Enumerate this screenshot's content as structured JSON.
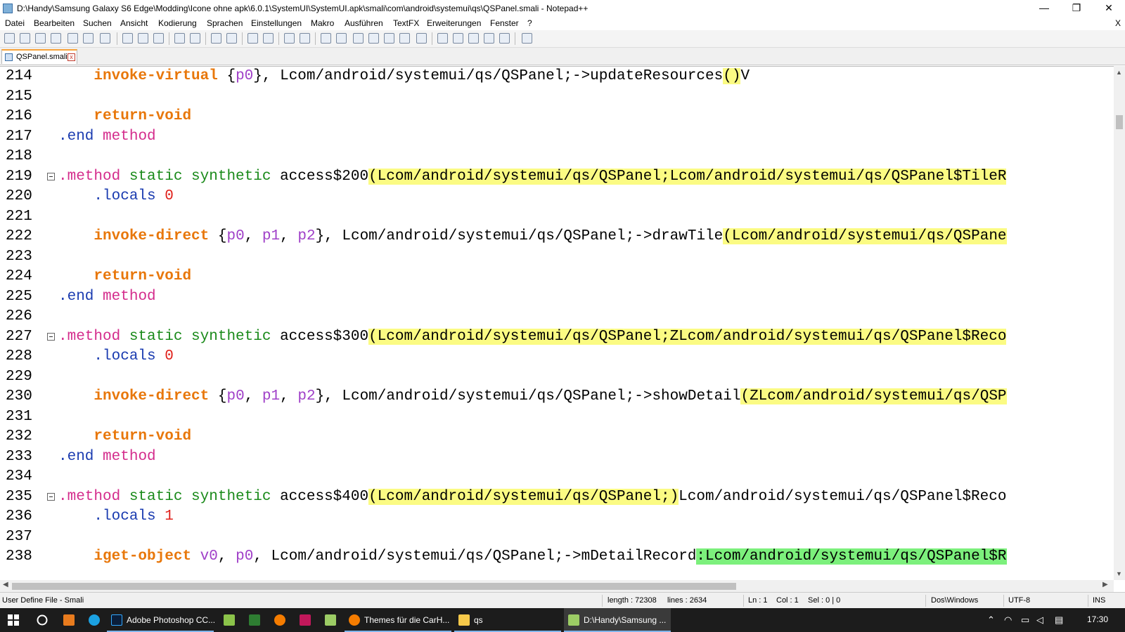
{
  "window": {
    "title": "D:\\Handy\\Samsung Galaxy S6 Edge\\Modding\\Icone ohne apk\\6.0.1\\SystemUI\\SystemUI.apk\\smali\\com\\android\\systemui\\qs\\QSPanel.smali - Notepad++",
    "minimize": "—",
    "restore": "❐",
    "close": "✕"
  },
  "menu": {
    "items": [
      "Datei",
      "Bearbeiten",
      "Suchen",
      "Ansicht",
      "Kodierung",
      "Sprachen",
      "Einstellungen",
      "Makro",
      "Ausführen",
      "TextFX",
      "Erweiterungen",
      "Fenster",
      "?"
    ],
    "doc_close": "X"
  },
  "tab": {
    "label": "QSPanel.smali",
    "close": "x"
  },
  "editor": {
    "lines": [
      {
        "n": "214",
        "tokens": [
          {
            "t": "    "
          },
          {
            "t": "invoke-virtual",
            "c": "kw-orange"
          },
          {
            "t": " {"
          },
          {
            "t": "p0",
            "c": "reg"
          },
          {
            "t": "}, Lcom/android/systemui/qs/QSPanel;->updateResources"
          },
          {
            "t": "()",
            "c": "hl-y"
          },
          {
            "t": "V"
          }
        ]
      },
      {
        "n": "215",
        "tokens": []
      },
      {
        "n": "216",
        "tokens": [
          {
            "t": "    "
          },
          {
            "t": "return-void",
            "c": "kw-orange"
          }
        ]
      },
      {
        "n": "217",
        "tokens": [
          {
            "t": ".end",
            "c": "kw-blue"
          },
          {
            "t": " "
          },
          {
            "t": "method",
            "c": "kw-pink"
          }
        ]
      },
      {
        "n": "218",
        "tokens": []
      },
      {
        "n": "219",
        "fold": true,
        "tokens": [
          {
            "t": ".method",
            "c": "kw-pink"
          },
          {
            "t": " "
          },
          {
            "t": "static synthetic",
            "c": "kw-green"
          },
          {
            "t": " access$200"
          },
          {
            "t": "(Lcom/android/systemui/qs/QSPanel;Lcom/android/systemui/qs/QSPanel$TileR",
            "c": "hl-y"
          }
        ]
      },
      {
        "n": "220",
        "tokens": [
          {
            "t": "    "
          },
          {
            "t": ".locals",
            "c": "kw-blue"
          },
          {
            "t": " "
          },
          {
            "t": "0",
            "c": "kw-red"
          }
        ]
      },
      {
        "n": "221",
        "tokens": []
      },
      {
        "n": "222",
        "tokens": [
          {
            "t": "    "
          },
          {
            "t": "invoke-direct",
            "c": "kw-orange"
          },
          {
            "t": " {"
          },
          {
            "t": "p0",
            "c": "reg"
          },
          {
            "t": ", "
          },
          {
            "t": "p1",
            "c": "reg"
          },
          {
            "t": ", "
          },
          {
            "t": "p2",
            "c": "reg"
          },
          {
            "t": "}, Lcom/android/systemui/qs/QSPanel;->drawTile"
          },
          {
            "t": "(Lcom/android/systemui/qs/QSPane",
            "c": "hl-y"
          }
        ]
      },
      {
        "n": "223",
        "tokens": []
      },
      {
        "n": "224",
        "tokens": [
          {
            "t": "    "
          },
          {
            "t": "return-void",
            "c": "kw-orange"
          }
        ]
      },
      {
        "n": "225",
        "tokens": [
          {
            "t": ".end",
            "c": "kw-blue"
          },
          {
            "t": " "
          },
          {
            "t": "method",
            "c": "kw-pink"
          }
        ]
      },
      {
        "n": "226",
        "tokens": []
      },
      {
        "n": "227",
        "fold": true,
        "tokens": [
          {
            "t": ".method",
            "c": "kw-pink"
          },
          {
            "t": " "
          },
          {
            "t": "static synthetic",
            "c": "kw-green"
          },
          {
            "t": " access$300"
          },
          {
            "t": "(Lcom/android/systemui/qs/QSPanel;ZLcom/android/systemui/qs/QSPanel$Reco",
            "c": "hl-y"
          }
        ]
      },
      {
        "n": "228",
        "tokens": [
          {
            "t": "    "
          },
          {
            "t": ".locals",
            "c": "kw-blue"
          },
          {
            "t": " "
          },
          {
            "t": "0",
            "c": "kw-red"
          }
        ]
      },
      {
        "n": "229",
        "tokens": []
      },
      {
        "n": "230",
        "tokens": [
          {
            "t": "    "
          },
          {
            "t": "invoke-direct",
            "c": "kw-orange"
          },
          {
            "t": " {"
          },
          {
            "t": "p0",
            "c": "reg"
          },
          {
            "t": ", "
          },
          {
            "t": "p1",
            "c": "reg"
          },
          {
            "t": ", "
          },
          {
            "t": "p2",
            "c": "reg"
          },
          {
            "t": "}, Lcom/android/systemui/qs/QSPanel;->showDetail"
          },
          {
            "t": "(ZLcom/android/systemui/qs/QSP",
            "c": "hl-y"
          }
        ]
      },
      {
        "n": "231",
        "tokens": []
      },
      {
        "n": "232",
        "tokens": [
          {
            "t": "    "
          },
          {
            "t": "return-void",
            "c": "kw-orange"
          }
        ]
      },
      {
        "n": "233",
        "tokens": [
          {
            "t": ".end",
            "c": "kw-blue"
          },
          {
            "t": " "
          },
          {
            "t": "method",
            "c": "kw-pink"
          }
        ]
      },
      {
        "n": "234",
        "tokens": []
      },
      {
        "n": "235",
        "fold": true,
        "tokens": [
          {
            "t": ".method",
            "c": "kw-pink"
          },
          {
            "t": " "
          },
          {
            "t": "static synthetic",
            "c": "kw-green"
          },
          {
            "t": " access$400"
          },
          {
            "t": "(Lcom/android/systemui/qs/QSPanel;)",
            "c": "hl-y"
          },
          {
            "t": "Lcom/android/systemui/qs/QSPanel$Reco"
          }
        ]
      },
      {
        "n": "236",
        "tokens": [
          {
            "t": "    "
          },
          {
            "t": ".locals",
            "c": "kw-blue"
          },
          {
            "t": " "
          },
          {
            "t": "1",
            "c": "kw-red"
          }
        ]
      },
      {
        "n": "237",
        "tokens": []
      },
      {
        "n": "238",
        "tokens": [
          {
            "t": "    "
          },
          {
            "t": "iget-object",
            "c": "kw-orange"
          },
          {
            "t": " "
          },
          {
            "t": "v0",
            "c": "reg"
          },
          {
            "t": ", "
          },
          {
            "t": "p0",
            "c": "reg"
          },
          {
            "t": ", Lcom/android/systemui/qs/QSPanel;->mDetailRecord"
          },
          {
            "t": ":Lcom/android/systemui/qs/QSPanel$R",
            "c": "hl-g"
          }
        ]
      }
    ]
  },
  "status": {
    "lang": "User Define File - Smali",
    "length": "length : 72308",
    "lines": "lines : 2634",
    "ln": "Ln : 1",
    "col": "Col : 1",
    "sel": "Sel : 0 | 0",
    "eol": "Dos\\Windows",
    "encoding": "UTF-8",
    "mode": "INS"
  },
  "taskbar": {
    "photoshop": "Adobe Photoshop CC...",
    "firefox": "Themes für die CarH...",
    "folder": "qs",
    "notepad": "D:\\Handy\\Samsung ...",
    "time": "17:30"
  }
}
